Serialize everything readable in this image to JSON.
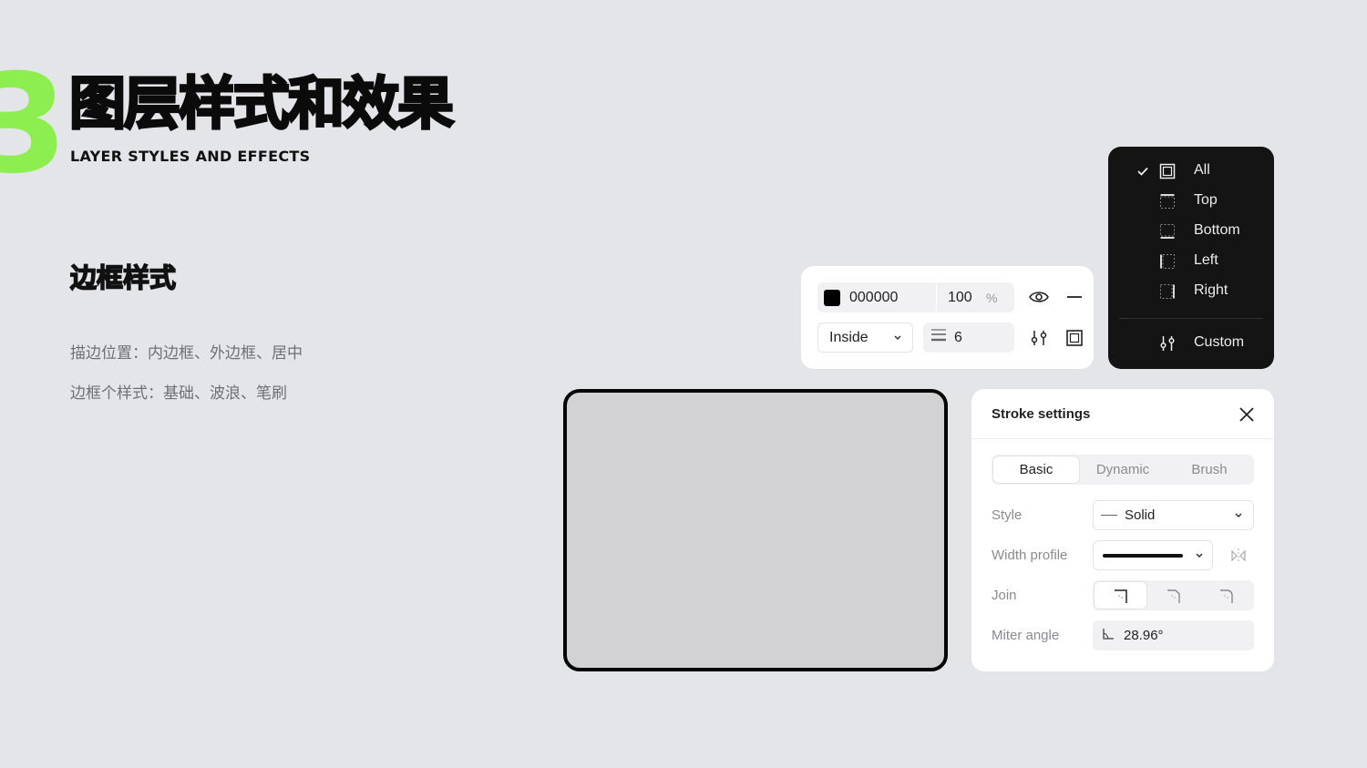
{
  "hero": {
    "number": "3",
    "title": "图层样式和效果",
    "subtitle": "LAYER STYLES AND EFFECTS"
  },
  "section": {
    "title": "边框样式",
    "desc_1": "描边位置：内边框、外边框、居中",
    "desc_2": "边框个样式：基础、波浪、笔刷"
  },
  "stroke_bar": {
    "color_hex": "000000",
    "opacity": "100",
    "opacity_unit": "%",
    "position": "Inside",
    "weight": "6"
  },
  "side_menu": {
    "items": [
      {
        "label": "All",
        "checked": true
      },
      {
        "label": "Top",
        "checked": false
      },
      {
        "label": "Bottom",
        "checked": false
      },
      {
        "label": "Left",
        "checked": false
      },
      {
        "label": "Right",
        "checked": false
      }
    ],
    "custom_label": "Custom"
  },
  "settings": {
    "title": "Stroke settings",
    "tabs": [
      "Basic",
      "Dynamic",
      "Brush"
    ],
    "active_tab": "Basic",
    "style_label": "Style",
    "style_value": "Solid",
    "width_profile_label": "Width profile",
    "join_label": "Join",
    "miter_label": "Miter angle",
    "miter_value": "28.96°"
  },
  "colors": {
    "accent": "#8cef4f",
    "background": "#e4e5e9",
    "panel": "#ffffff",
    "menu": "#141414"
  }
}
